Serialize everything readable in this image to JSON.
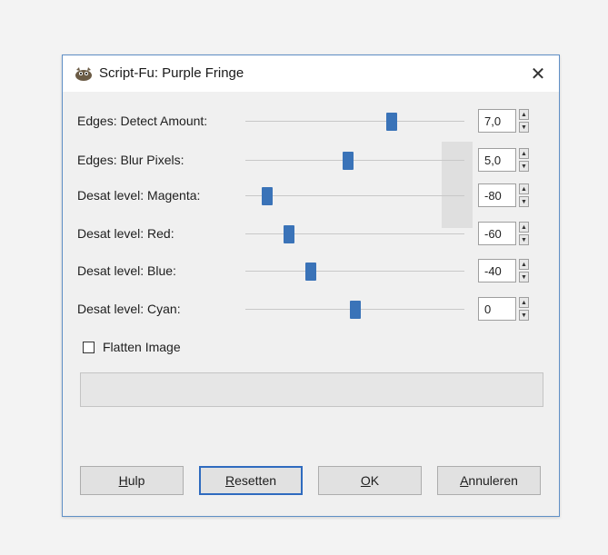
{
  "dialog": {
    "title": "Script-Fu: Purple Fringe",
    "close_label": "✕"
  },
  "params": [
    {
      "label": "Edges: Detect Amount:",
      "value": "7,0",
      "level": 0.67
    },
    {
      "label": "Edges: Blur Pixels:",
      "value": "5,0",
      "level": 0.47
    },
    {
      "label": "Desat level: Magenta:",
      "value": "-80",
      "level": 0.1
    },
    {
      "label": "Desat level: Red:",
      "value": "-60",
      "level": 0.2
    },
    {
      "label": "Desat level: Blue:",
      "value": "-40",
      "level": 0.3
    },
    {
      "label": "Desat level: Cyan:",
      "value": "0",
      "level": 0.5
    }
  ],
  "flatten": {
    "label": "Flatten Image",
    "checked": false
  },
  "progress": {
    "value": 0
  },
  "buttons": {
    "help": {
      "first": "H",
      "rest": "ulp"
    },
    "reset": {
      "first": "R",
      "rest": "esetten"
    },
    "ok": {
      "first": "O",
      "rest": "K"
    },
    "cancel": {
      "first": "A",
      "rest": "nnuleren"
    }
  },
  "colors": {
    "accent": "#3a73b8",
    "border": "#5f8fc6"
  },
  "icons": {
    "app": "gimp-icon",
    "close": "close-icon",
    "spin_up": "spin-up-icon",
    "spin_down": "spin-down-icon"
  }
}
